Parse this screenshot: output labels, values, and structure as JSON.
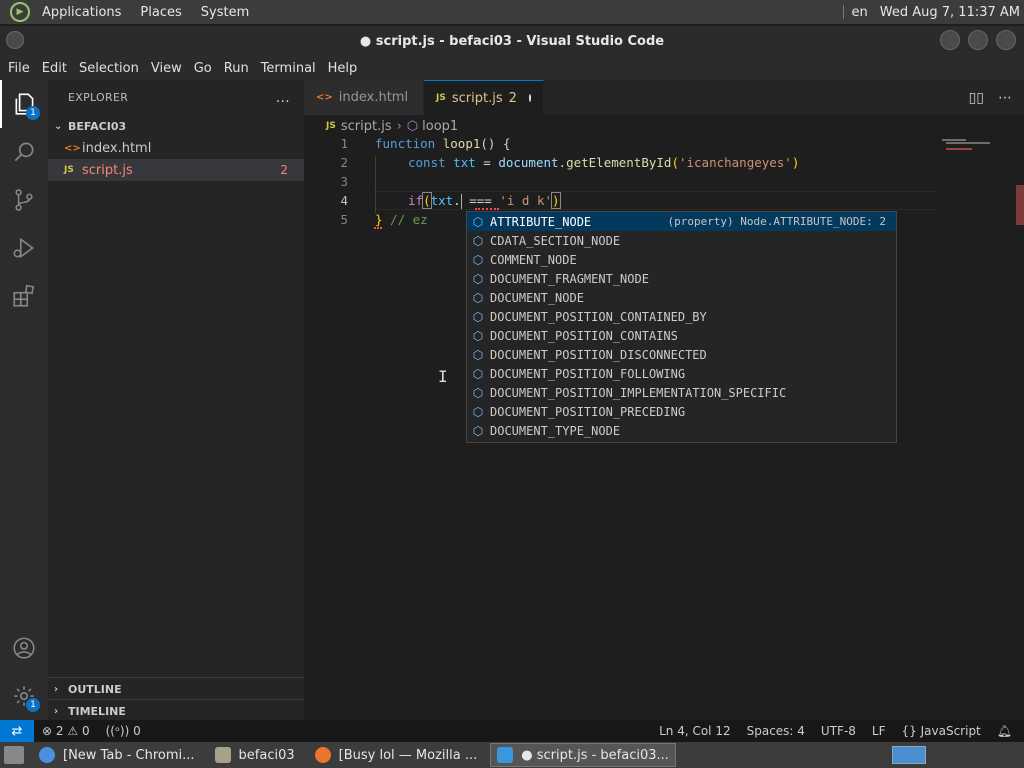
{
  "top_panel": {
    "menus": [
      "Applications",
      "Places",
      "System"
    ],
    "keyboard_layout": "en",
    "clock": "Wed Aug  7, 11:37 AM"
  },
  "window": {
    "title": "● script.js - befaci03 - Visual Studio Code"
  },
  "menubar": [
    "File",
    "Edit",
    "Selection",
    "View",
    "Go",
    "Run",
    "Terminal",
    "Help"
  ],
  "activity_bar": {
    "explorer_badge": "1",
    "manage_badge": "1"
  },
  "sidebar": {
    "title": "EXPLORER",
    "more_icon": "…",
    "folder": "BEFACI03",
    "files": [
      {
        "icon": "<>",
        "name": "index.html"
      },
      {
        "icon": "JS",
        "name": "script.js",
        "problems": "2"
      }
    ],
    "outline": "OUTLINE",
    "timeline": "TIMELINE"
  },
  "tabs": [
    {
      "icon": "<>",
      "label": "index.html"
    },
    {
      "icon": "JS",
      "label": "script.js",
      "count": "2"
    }
  ],
  "breadcrumb": {
    "file_icon": "JS",
    "file": "script.js",
    "symbol": "loop1"
  },
  "code": {
    "line_numbers": [
      "1",
      "2",
      "3",
      "4",
      "5"
    ],
    "l1": {
      "kw": "function",
      "fn": "loop1",
      "rest": "() {"
    },
    "l2": {
      "kw": "const",
      "var": "txt",
      "eq": " = ",
      "obj": "document",
      "dot": ".",
      "method": "getElementById",
      "open": "(",
      "str": "'icanchangeyes'",
      "close": ")"
    },
    "l4": {
      "kw": "if",
      "open": "(",
      "var": "txt",
      "dot": ".",
      "op": " === ",
      "str": "'i d k'",
      "close": ")"
    },
    "l5": {
      "brace": "}",
      "cmt": " // ez"
    }
  },
  "suggestions": {
    "selected_detail": "(property) Node.ATTRIBUTE_NODE: 2",
    "items": [
      "ATTRIBUTE_NODE",
      "CDATA_SECTION_NODE",
      "COMMENT_NODE",
      "DOCUMENT_FRAGMENT_NODE",
      "DOCUMENT_NODE",
      "DOCUMENT_POSITION_CONTAINED_BY",
      "DOCUMENT_POSITION_CONTAINS",
      "DOCUMENT_POSITION_DISCONNECTED",
      "DOCUMENT_POSITION_FOLLOWING",
      "DOCUMENT_POSITION_IMPLEMENTATION_SPECIFIC",
      "DOCUMENT_POSITION_PRECEDING",
      "DOCUMENT_TYPE_NODE"
    ]
  },
  "statusbar": {
    "errors": "2",
    "warnings": "0",
    "ports": "0",
    "position": "Ln 4, Col 12",
    "spaces": "Spaces: 4",
    "encoding": "UTF-8",
    "eol": "LF",
    "language": "JavaScript"
  },
  "taskbar": [
    {
      "label": "[New Tab - Chromi...",
      "color": "#4b8fe0"
    },
    {
      "label": "befaci03",
      "color": "#a7a08a"
    },
    {
      "label": "[Busy lol — Mozilla ...",
      "color": "#e8762d"
    },
    {
      "label": "● script.js - befaci03...",
      "color": "#3a96dd"
    }
  ],
  "colors": {
    "accent": "#0078d4",
    "modified": "#e2c08d",
    "error": "#f14c4c"
  }
}
